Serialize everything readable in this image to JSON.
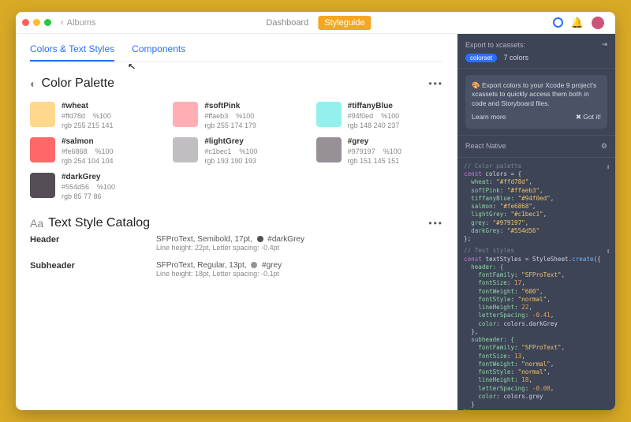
{
  "titlebar": {
    "back_label": "Albums"
  },
  "topnav": {
    "dashboard": "Dashboard",
    "styleguide": "Styleguide"
  },
  "tabs": {
    "colors": "Colors & Text Styles",
    "components": "Components"
  },
  "palette": {
    "title": "Color Palette",
    "items": [
      {
        "name": "#wheat",
        "hex": "#ffd78d",
        "pct": "%100",
        "rgb": "rgb 255 215 141",
        "swatch": "#ffd78d"
      },
      {
        "name": "#softPink",
        "hex": "#ffaeb3",
        "pct": "%100",
        "rgb": "rgb 255 174 179",
        "swatch": "#ffaeb3"
      },
      {
        "name": "#tiffanyBlue",
        "hex": "#94f0ed",
        "pct": "%100",
        "rgb": "rgb 148 240 237",
        "swatch": "#94f0ed"
      },
      {
        "name": "#salmon",
        "hex": "#fe6868",
        "pct": "%100",
        "rgb": "rgb 254 104 104",
        "swatch": "#fe6868"
      },
      {
        "name": "#lightGrey",
        "hex": "#c1bec1",
        "pct": "%100",
        "rgb": "rgb 193 190 193",
        "swatch": "#c1bec1"
      },
      {
        "name": "#grey",
        "hex": "#979197",
        "pct": "%100",
        "rgb": "rgb 151 145 151",
        "swatch": "#979197"
      },
      {
        "name": "#darkGrey",
        "hex": "#554d56",
        "pct": "%100",
        "rgb": "rgb 85 77 86",
        "swatch": "#554d56"
      }
    ]
  },
  "textstyles": {
    "title": "Text Style Catalog",
    "rows": [
      {
        "name": "Header",
        "spec": "SFProText, Semibold, 17pt,",
        "badge": "#554d56",
        "badgeName": "#darkGrey",
        "line2": "Line height: 22pt, Letter spacing: -0.4pt"
      },
      {
        "name": "Subheader",
        "spec": "SFProText, Regular, 13pt,",
        "badge": "#979197",
        "badgeName": "#grey",
        "line2": "Line height: 18pt, Letter spacing: -0.1pt"
      }
    ]
  },
  "side": {
    "export_title": "Export to xcassets:",
    "pill": "colorset",
    "pill_count": "7 colors",
    "banner": "🎨 Export colors to your Xcode 9 project's xcassets to quickly access them both in code and Storyboard files.",
    "learn": "Learn more",
    "gotit": "✖ Got it!",
    "rn_title": "React Native",
    "code1": {
      "cm": "// Color palette",
      "l1a": "const",
      "l1b": " colors = {",
      "lines": [
        {
          "k": "wheat",
          "v": "\"#ffd78d\""
        },
        {
          "k": "softPink",
          "v": "\"#ffaeb3\""
        },
        {
          "k": "tiffanyBlue",
          "v": "\"#94f0ed\""
        },
        {
          "k": "salmon",
          "v": "\"#fe6868\""
        },
        {
          "k": "lightGrey",
          "v": "\"#c1bec1\""
        },
        {
          "k": "grey",
          "v": "\"#979197\""
        },
        {
          "k": "darkGrey",
          "v": "\"#554d56\""
        }
      ],
      "close": "};"
    },
    "code2": {
      "cm": "// Text styles",
      "l1a": "const",
      "l1b": " textStyles = StyleSheet.",
      "l1c": "create",
      "l1d": "({",
      "h_open": "  header: {",
      "h": [
        {
          "k": "fontFamily",
          "v": "\"SFProText\""
        },
        {
          "k": "fontSize",
          "v": "17"
        },
        {
          "k": "fontWeight",
          "v": "\"600\""
        },
        {
          "k": "fontStyle",
          "v": "\"normal\""
        },
        {
          "k": "lineHeight",
          "v": "22"
        },
        {
          "k": "letterSpacing",
          "v": "-0.41"
        },
        {
          "k": "color",
          "v": "colors.darkGrey"
        }
      ],
      "h_close": "  },",
      "s_open": "  subheader: {",
      "s": [
        {
          "k": "fontFamily",
          "v": "\"SFProText\""
        },
        {
          "k": "fontSize",
          "v": "13"
        },
        {
          "k": "fontWeight",
          "v": "\"normal\""
        },
        {
          "k": "fontStyle",
          "v": "\"normal\""
        },
        {
          "k": "lineHeight",
          "v": "18"
        },
        {
          "k": "letterSpacing",
          "v": "-0.08"
        },
        {
          "k": "color",
          "v": "colors.grey"
        }
      ],
      "s_close": "  }",
      "close": "});"
    }
  }
}
